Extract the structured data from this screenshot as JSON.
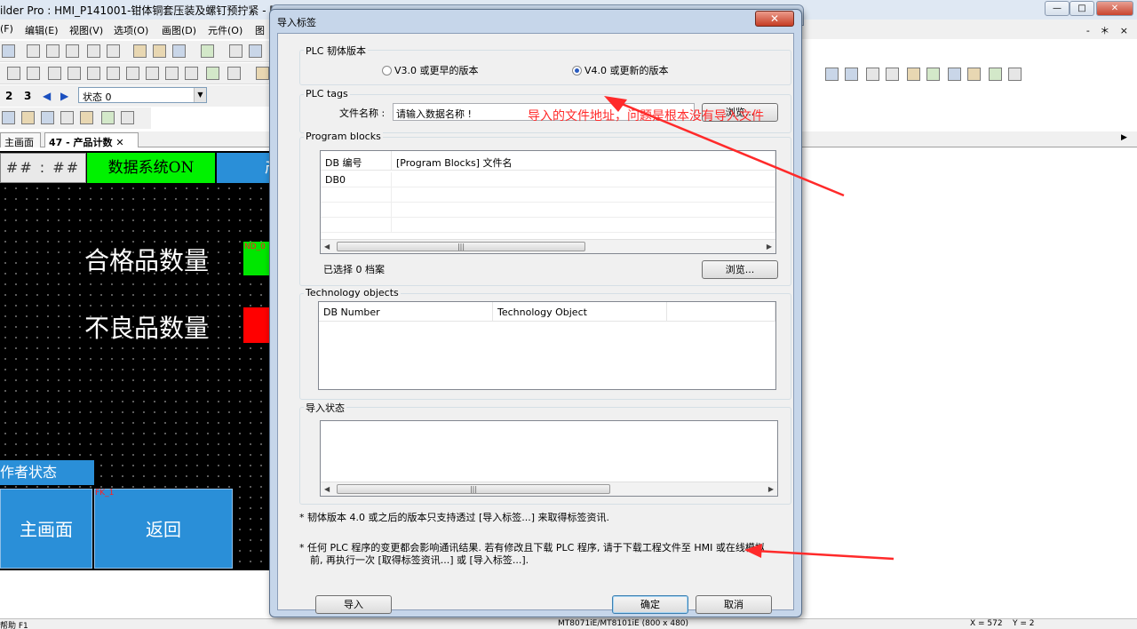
{
  "app": {
    "title": "ilder Pro : HMI_P141001-钳体铜套压装及螺钉预拧紧 - [47 - 产品计数 ]",
    "controls": [
      "—",
      "□",
      "✕"
    ],
    "mdi_controls": "- ＊ ×"
  },
  "menu": [
    "(F)",
    "编辑(E)",
    "视图(V)",
    "选项(O)",
    "画图(D)",
    "元件(O)",
    "图"
  ],
  "statebar": {
    "n2": "2",
    "n3": "3",
    "state_value": "状态 0"
  },
  "tabs": [
    {
      "label": "主画面"
    },
    {
      "label": "47 - 产品计数 ✕"
    }
  ],
  "hmi": {
    "clock": "## : ##",
    "system_on": "数据系统ON",
    "top_right": "产",
    "good_label": "合格品数量",
    "bad_label": "不良品数量",
    "good_tag": "ND_0",
    "operator_state": "作者状态",
    "main_button": "主画面",
    "back_button": "返回",
    "fk_tag": "FK_1"
  },
  "statusbar": {
    "left": "帮助 F1",
    "model": "MT8071iE/MT8101iE (800 x 480)",
    "x": "X = 572",
    "y": "Y = 2"
  },
  "dialog": {
    "title": "导入标签",
    "close": "✕",
    "firmware": {
      "group_label": "PLC 韧体版本",
      "option_v3": "V3.0 或更早的版本",
      "option_v4": "V4.0 或更新的版本",
      "selected": "V4.0 或更新的版本"
    },
    "plc_tags": {
      "group_label": "PLC tags",
      "file_label": "文件名称 :",
      "file_value": "请输入数据名称 !",
      "browse": "浏览..."
    },
    "program_blocks": {
      "group_label": "Program blocks",
      "columns": [
        "DB 编号",
        "[Program Blocks] 文件名"
      ],
      "rows": [
        [
          "DB0",
          ""
        ]
      ],
      "selected_count": "已选择 0 档案",
      "browse": "浏览..."
    },
    "technology_objects": {
      "group_label": "Technology objects",
      "columns": [
        "DB Number",
        "Technology Object"
      ]
    },
    "import_status": {
      "group_label": "导入状态"
    },
    "notes": [
      "*  韧体版本 4.0 或之后的版本只支持透过 [导入标签...] 来取得标签资讯.",
      "*  任何 PLC 程序的变更都会影响通讯结果. 若有修改且下载 PLC 程序, 请于下载工程文件至 HMI 或在线模拟",
      "前, 再执行一次 [取得标签资讯...] 或 [导入标签...]."
    ],
    "buttons": {
      "import": "导入",
      "ok": "确定",
      "cancel": "取消"
    }
  },
  "annotation": {
    "text": "导入的文件地址，问题是根本没有导入文件",
    "color": "#ff2a2a"
  },
  "colors": {
    "hmi_green": "#00f200",
    "hmi_blue": "#2a8fd8",
    "hmi_red": "#ff0000"
  }
}
